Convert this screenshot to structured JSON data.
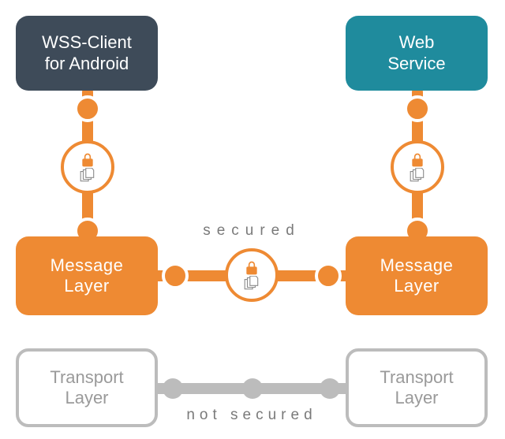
{
  "colors": {
    "dark": "#3e4b59",
    "teal": "#1f8b9d",
    "orange": "#ee8a33",
    "gray": "#bcbcbc",
    "text_muted": "#7a7a7a"
  },
  "nodes": {
    "client": {
      "line1": "WSS-Client",
      "line2": "for Android"
    },
    "service": {
      "line1": "Web",
      "line2": "Service"
    },
    "msg_left": {
      "line1": "Message",
      "line2": "Layer"
    },
    "msg_right": {
      "line1": "Message",
      "line2": "Layer"
    },
    "trans_left": {
      "line1": "Transport",
      "line2": "Layer"
    },
    "trans_right": {
      "line1": "Transport",
      "line2": "Layer"
    }
  },
  "labels": {
    "secured": "secured",
    "not_secured": "not secured"
  },
  "badges": {
    "left": {
      "icon1": "lock-icon",
      "icon2": "files-icon"
    },
    "right": {
      "icon1": "lock-icon",
      "icon2": "files-icon"
    },
    "center": {
      "icon1": "lock-icon",
      "icon2": "files-icon"
    }
  },
  "edges": {
    "top_secured": [
      {
        "from": "client",
        "to": "msg_left",
        "style": "orange",
        "badge": "left"
      },
      {
        "from": "service",
        "to": "msg_right",
        "style": "orange",
        "badge": "right"
      },
      {
        "from": "msg_left",
        "to": "msg_right",
        "style": "orange",
        "badge": "center",
        "label": "secured"
      }
    ],
    "bottom_unsecured": [
      {
        "from": "trans_left",
        "to": "trans_right",
        "style": "gray",
        "label": "not_secured"
      }
    ]
  }
}
